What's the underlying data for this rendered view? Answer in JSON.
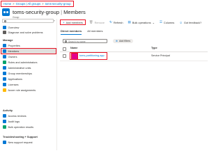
{
  "breadcrumb": [
    "Home",
    "Groups | All groups",
    "toms-security-group"
  ],
  "header": {
    "group_name": "toms-security-group",
    "page": "Members",
    "subtitle": "Group"
  },
  "sidebar": {
    "search_placeholder": "",
    "collapse_label": "«",
    "items": [
      {
        "label": "Overview",
        "icon": "overview-icon",
        "color": "#0078d4"
      },
      {
        "label": "Diagnose and solve problems",
        "icon": "wrench-icon",
        "color": "#605e5c"
      }
    ],
    "manage_title": "Manage",
    "manage_items": [
      {
        "label": "Properties",
        "icon": "properties-icon",
        "color": "#0078d4"
      },
      {
        "label": "Members",
        "icon": "members-icon",
        "color": "#0078d4"
      },
      {
        "label": "Owners",
        "icon": "owners-icon",
        "color": "#0078d4"
      },
      {
        "label": "Roles and administrators",
        "icon": "roles-icon",
        "color": "#00a36c"
      },
      {
        "label": "Administrative units",
        "icon": "admin-units-icon",
        "color": "#0078d4"
      },
      {
        "label": "Group memberships",
        "icon": "group-memberships-icon",
        "color": "#0078d4"
      },
      {
        "label": "Applications",
        "icon": "applications-icon",
        "color": "#0078d4"
      },
      {
        "label": "Licenses",
        "icon": "licenses-icon",
        "color": "#0078d4"
      },
      {
        "label": "Azure role assignments",
        "icon": "key-icon",
        "color": "#ffb900"
      }
    ],
    "activity_title": "Activity",
    "activity_items": [
      {
        "label": "Access reviews",
        "icon": "access-reviews-icon",
        "color": "#0078d4"
      },
      {
        "label": "Audit logs",
        "icon": "audit-logs-icon",
        "color": "#0078d4"
      },
      {
        "label": "Bulk operation results",
        "icon": "bulk-results-icon",
        "color": "#00a36c"
      }
    ],
    "troubleshoot_title": "Troubleshooting + Support",
    "troubleshoot_items": [
      {
        "label": "New support request",
        "icon": "support-icon",
        "color": "#0078d4"
      }
    ]
  },
  "toolbar": {
    "add_members": "Add members",
    "remove": "Remove",
    "refresh": "Refresh",
    "bulk_operations": "Bulk operations",
    "columns": "Columns",
    "got_feedback": "Got feedback?"
  },
  "tabs": [
    "Direct members",
    "All members"
  ],
  "search": {
    "placeholder": "Search by name"
  },
  "add_filters": "Add filters",
  "table": {
    "columns": [
      "Name",
      "Type"
    ],
    "rows": [
      {
        "name": "toms-partitioning-app",
        "type": "Service Principal",
        "badge_color": "#e3008c"
      }
    ]
  },
  "colors": {
    "accent": "#0078d4",
    "highlight": "#e81123"
  }
}
